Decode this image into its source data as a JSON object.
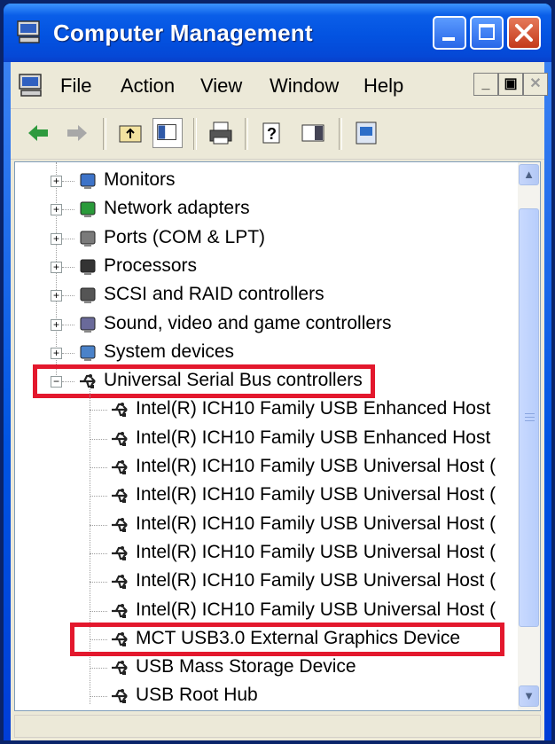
{
  "window": {
    "title": "Computer Management"
  },
  "menu": {
    "items": [
      "File",
      "Action",
      "View",
      "Window",
      "Help"
    ]
  },
  "tree": {
    "collapsed_nodes": [
      "Monitors",
      "Network adapters",
      "Ports (COM & LPT)",
      "Processors",
      "SCSI and RAID controllers",
      "Sound, video and game controllers",
      "System devices"
    ],
    "expanded_node": "Universal Serial Bus controllers",
    "children": [
      "Intel(R) ICH10 Family USB Enhanced Host",
      "Intel(R) ICH10 Family USB Enhanced Host",
      "Intel(R) ICH10 Family USB Universal Host (",
      "Intel(R) ICH10 Family USB Universal Host (",
      "Intel(R) ICH10 Family USB Universal Host (",
      "Intel(R) ICH10 Family USB Universal Host (",
      "Intel(R) ICH10 Family USB Universal Host (",
      "Intel(R) ICH10 Family USB Universal Host (",
      "MCT USB3.0 External Graphics Device",
      "USB Mass Storage Device",
      "USB Root Hub"
    ],
    "highlighted": [
      "Universal Serial Bus controllers",
      "MCT USB3.0 External Graphics Device"
    ]
  },
  "colors": {
    "highlight": "#e3182d",
    "titlebar": "#0a5ee8"
  },
  "icons": {
    "collapsed_nodes": [
      "monitor-icon",
      "network-adapter-icon",
      "port-icon",
      "processor-icon",
      "scsi-icon",
      "sound-icon",
      "system-device-icon"
    ],
    "usb": "usb-icon"
  }
}
